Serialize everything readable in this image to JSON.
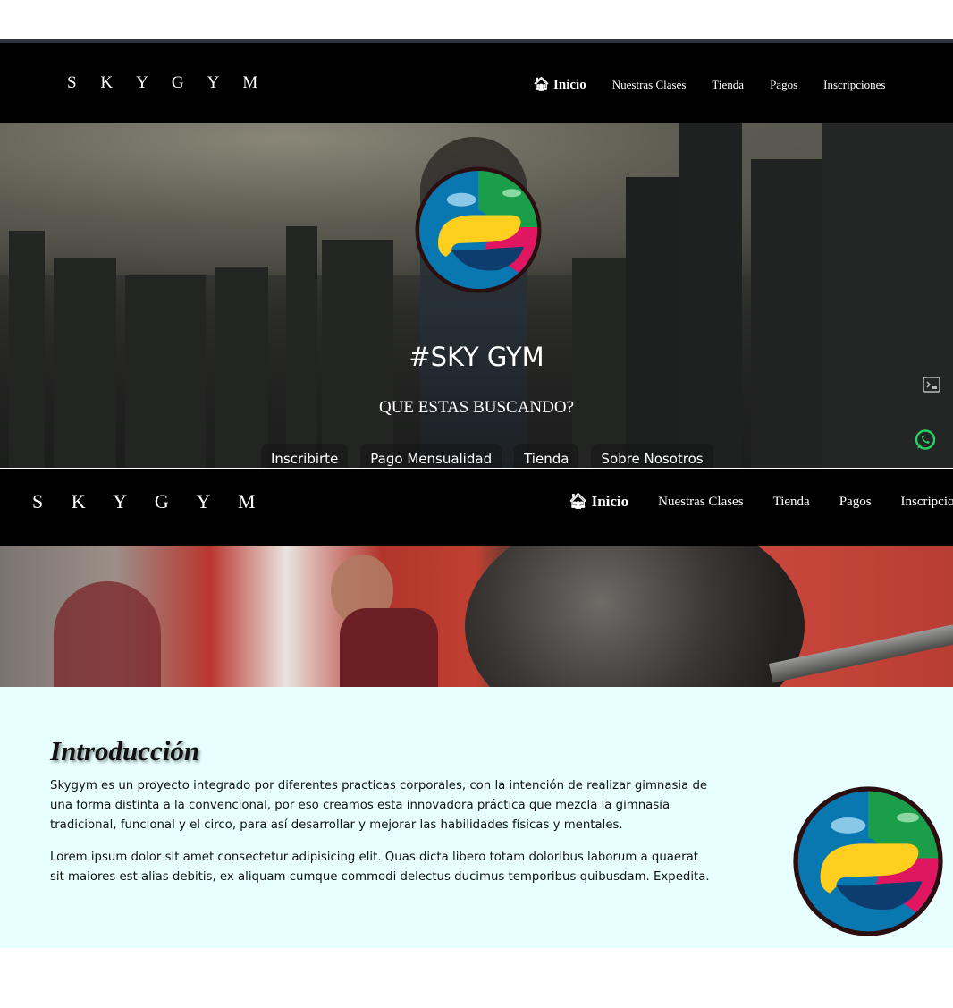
{
  "brand": "S K Y   G Y M",
  "nav": {
    "items": [
      {
        "label": "Inicio",
        "active": true,
        "icon": "home-icon"
      },
      {
        "label": "Nuestras Clases"
      },
      {
        "label": "Tienda"
      },
      {
        "label": "Pagos"
      },
      {
        "label": "Inscripciones"
      }
    ],
    "items_cropped_last": "Inscripcion"
  },
  "hero": {
    "title": "#SKY GYM",
    "subtitle": "QUE ESTAS BUSCANDO?",
    "buttons": [
      "Inscribirte",
      "Pago Mensualidad",
      "Tienda",
      "Sobre Nosotros"
    ]
  },
  "side_icons": [
    "console-icon",
    "whatsapp-icon"
  ],
  "intro": {
    "title": "Introducción",
    "paragraphs": [
      "Skygym es un proyecto integrado por diferentes practicas corporales, con la intención de realizar gimnasia de una forma distinta a la convencional, por eso creamos esta innovadora práctica que mezcla la gimnasia tradicional, funcional y el circo, para así desarrollar y mejorar las habilidades físicas y mentales.",
      "Lorem ipsum dolor sit amet consectetur adipisicing elit. Quas dicta libero totam doloribus laborum a quaerat sit maiores est alias debitis, ex aliquam cumque commodi delectus ducimus temporibus quibusdam. Expedita."
    ]
  },
  "colors": {
    "nav_bg": "#000000",
    "intro_bg": "#e8ffff",
    "whatsapp": "#25d366"
  }
}
